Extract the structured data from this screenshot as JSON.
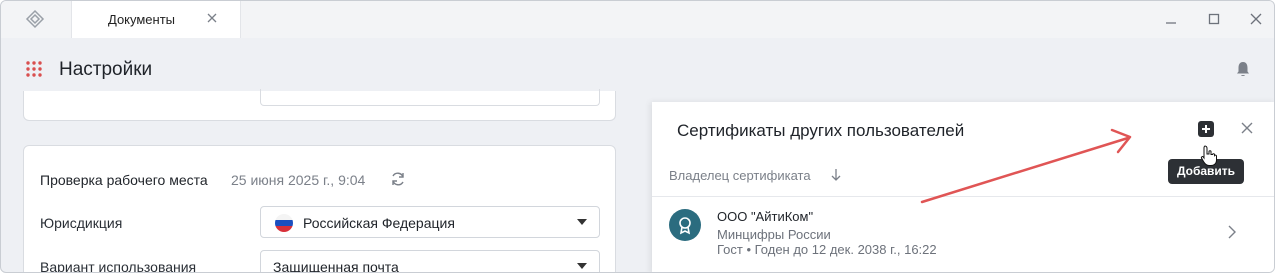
{
  "tab": {
    "label": "Документы"
  },
  "header": {
    "title": "Настройки"
  },
  "workplace_check": {
    "title": "Проверка рабочего места",
    "date": "25 июня 2025 г., 9:04",
    "fields": [
      {
        "label": "Юрисдикция",
        "value": "Российская Федерация"
      },
      {
        "label": "Вариант использования",
        "value": "Защищенная почта"
      }
    ]
  },
  "panel": {
    "title": "Сертификаты других пользователей",
    "column_header": "Владелец сертификата",
    "certificates": [
      {
        "owner": "ООО \"АйтиКом\"",
        "issuer": "Минцифры России",
        "meta": "Гост • Годен до 12 дек. 2038 г., 16:22"
      }
    ]
  },
  "tooltip": {
    "label": "Добавить"
  },
  "colors": {
    "accent_red": "#d94f4f",
    "avatar": "#2b6c7f",
    "annotation_arrow": "#e05555"
  },
  "icons": [
    "app-logo-icon",
    "close-icon",
    "minimize-icon",
    "maximize-icon",
    "apps-grid-icon",
    "bell-icon",
    "refresh-icon",
    "add-icon",
    "sort-down-icon",
    "chevron-right-icon",
    "certificate-icon",
    "cursor-icon"
  ]
}
